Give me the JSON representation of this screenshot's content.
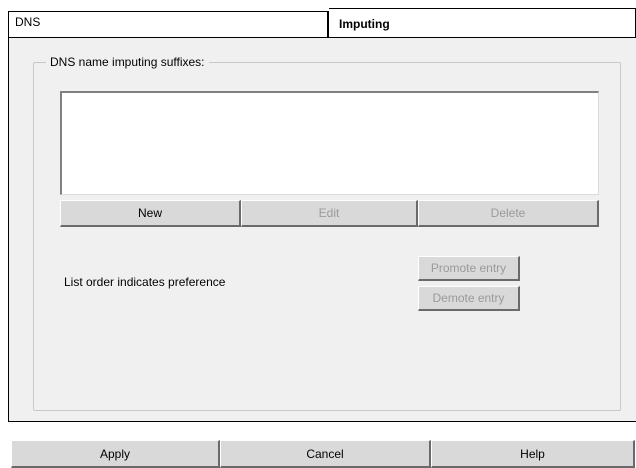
{
  "tabs": [
    {
      "label": "DNS",
      "active": false
    },
    {
      "label": "Imputing",
      "active": true
    }
  ],
  "group": {
    "label": "DNS name imputing suffixes:",
    "items": []
  },
  "list_buttons": {
    "new": "New",
    "edit": "Edit",
    "delete": "Delete"
  },
  "order": {
    "note": "List order indicates preference",
    "promote": "Promote entry",
    "demote": "Demote entry"
  },
  "footer": {
    "apply": "Apply",
    "cancel": "Cancel",
    "help": "Help"
  },
  "colors": {
    "panel": "#f0f0f0",
    "button": "#d9d9d9",
    "disabled_text": "#9a9a9a"
  }
}
